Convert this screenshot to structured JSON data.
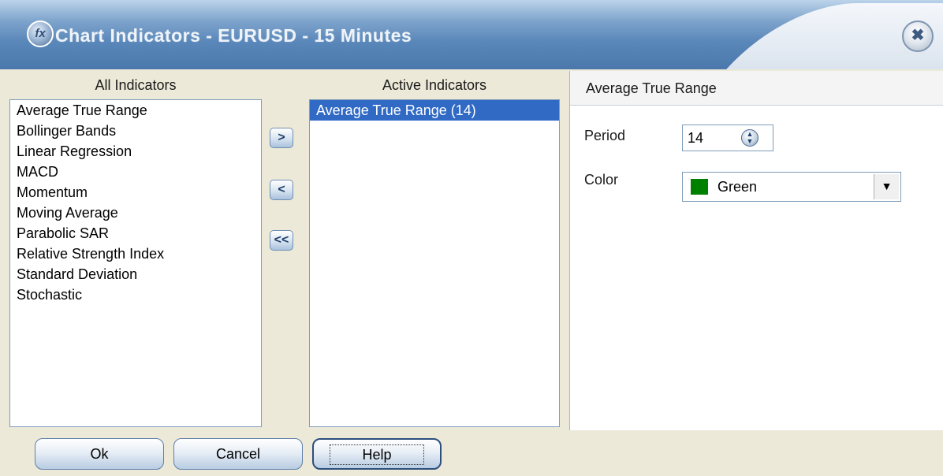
{
  "window": {
    "title": "Chart Indicators - EURUSD - 15 Minutes",
    "app_icon_text": "fx"
  },
  "all_indicators": {
    "header": "All Indicators",
    "items": [
      "Average True Range",
      "Bollinger Bands",
      "Linear Regression",
      "MACD",
      "Momentum",
      "Moving Average",
      "Parabolic SAR",
      "Relative Strength Index",
      "Standard Deviation",
      "Stochastic"
    ]
  },
  "move_buttons": {
    "add": ">",
    "remove": "<",
    "remove_all": "<<"
  },
  "active_indicators": {
    "header": "Active Indicators",
    "items": [
      "Average True Range (14)"
    ],
    "selected_index": 0
  },
  "properties": {
    "title": "Average True Range",
    "period_label": "Period",
    "period_value": "14",
    "color_label": "Color",
    "color_value": "Green",
    "color_swatch": "#008000"
  },
  "buttons": {
    "ok": "Ok",
    "cancel": "Cancel",
    "help": "Help"
  },
  "icons": {
    "close": "close-icon",
    "spin": "spin-updown-icon",
    "dropdown": "chevron-down-icon"
  }
}
